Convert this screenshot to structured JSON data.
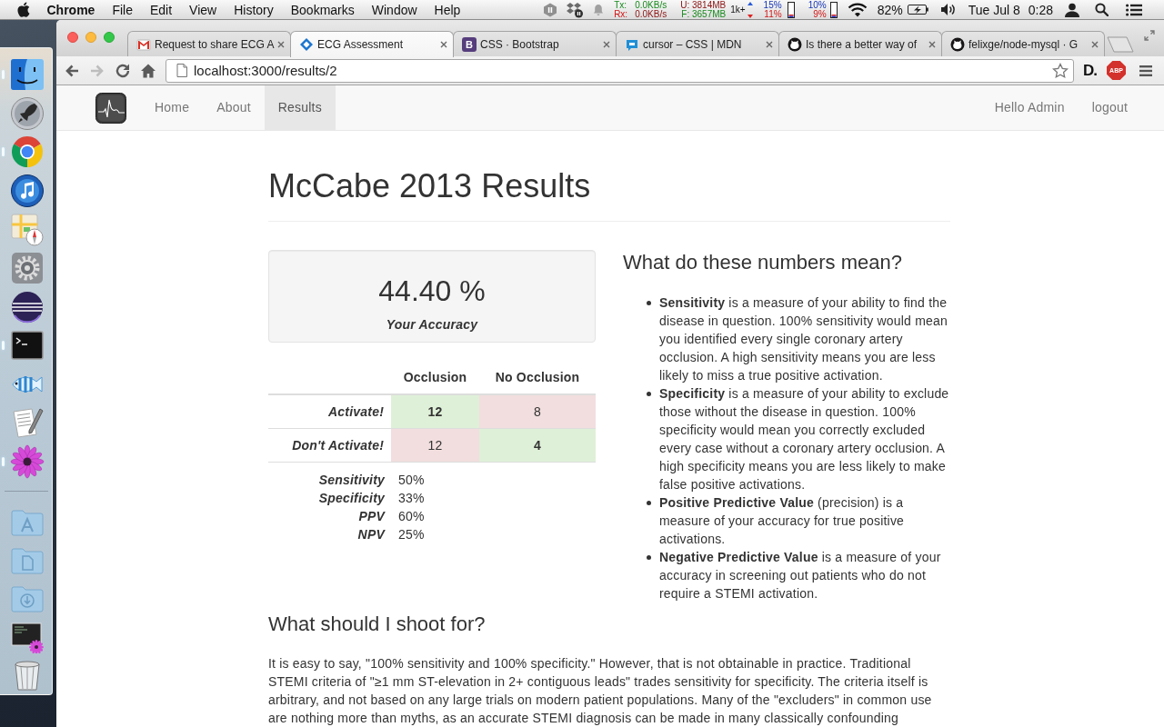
{
  "menu_bar": {
    "app_name": "Chrome",
    "menus": [
      "File",
      "Edit",
      "View",
      "History",
      "Bookmarks",
      "Window",
      "Help"
    ],
    "network": {
      "tx_label": "Tx:",
      "tx": "0.0KB/s",
      "rx_label": "Rx:",
      "rx": "0.0KB/s"
    },
    "memory": {
      "used": "U: 3814MB",
      "free": "F: 3657MB"
    },
    "counter": "1k+",
    "cpu": [
      {
        "user": "15%",
        "system": "11%"
      },
      {
        "user": "10%",
        "system": "9%"
      }
    ],
    "battery": "82%",
    "date": "Tue Jul 8",
    "time": "0:28"
  },
  "dock": {
    "apps": [
      {
        "kind": "finder",
        "running": true
      },
      {
        "kind": "launchpad",
        "running": false
      },
      {
        "kind": "chrome",
        "running": true
      },
      {
        "kind": "itunes",
        "running": false
      },
      {
        "kind": "maps",
        "running": false
      },
      {
        "kind": "preferences",
        "running": false
      },
      {
        "kind": "eclipse",
        "running": false
      },
      {
        "kind": "terminal",
        "running": true
      },
      {
        "kind": "fish",
        "running": false
      },
      {
        "kind": "textedit",
        "running": false
      },
      {
        "kind": "flower",
        "running": true
      }
    ],
    "stacks": [
      {
        "kind": "applications"
      },
      {
        "kind": "documents"
      },
      {
        "kind": "downloads"
      },
      {
        "kind": "screenshots"
      },
      {
        "kind": "trash"
      }
    ]
  },
  "browser": {
    "tabs": [
      {
        "title": "Request to share ECG A",
        "favicon": {
          "kind": "mail"
        },
        "selected": false
      },
      {
        "title": "ECG Assessment",
        "favicon": {
          "kind": "diamond"
        },
        "selected": true
      },
      {
        "title": "CSS · Bootstrap",
        "favicon": {
          "kind": "letter",
          "text": "B"
        },
        "selected": false
      },
      {
        "title": "cursor – CSS | MDN",
        "favicon": {
          "kind": "bubble"
        },
        "selected": false
      },
      {
        "title": "Is there a better way of",
        "favicon": {
          "kind": "cat"
        },
        "selected": false
      },
      {
        "title": "felixge/node-mysql · G",
        "favicon": {
          "kind": "cat"
        },
        "selected": false
      }
    ],
    "nav_buttons": [
      {
        "kind": "back",
        "disabled": false
      },
      {
        "kind": "forward",
        "disabled": true
      },
      {
        "kind": "reload",
        "disabled": false
      },
      {
        "kind": "home",
        "disabled": false
      }
    ],
    "address": "localhost:3000/results/2",
    "extensions": [
      {
        "kind": "letter",
        "text": "D."
      },
      {
        "kind": "octagon",
        "text": "ABP"
      }
    ]
  },
  "page": {
    "navbar": {
      "links": [
        {
          "label": "Home",
          "selected": false
        },
        {
          "label": "About",
          "selected": false
        },
        {
          "label": "Results",
          "selected": true
        }
      ],
      "greeting": "Hello Admin",
      "logout": "logout"
    },
    "title": "McCabe 2013 Results",
    "accuracy": {
      "value": "44.40 %",
      "label": "Your Accuracy"
    },
    "confusion_table": {
      "columns": [
        "Occlusion",
        "No Occlusion"
      ],
      "rows": [
        {
          "label": "Activate!",
          "cells": [
            {
              "value": "12",
              "correct": true
            },
            {
              "value": "8",
              "correct": false
            }
          ]
        },
        {
          "label": "Don't Activate!",
          "cells": [
            {
              "value": "12",
              "correct": false
            },
            {
              "value": "4",
              "correct": true
            }
          ]
        }
      ]
    },
    "stats": [
      {
        "label": "Sensitivity",
        "value": "50%"
      },
      {
        "label": "Specificity",
        "value": "33%"
      },
      {
        "label": "PPV",
        "value": "60%"
      },
      {
        "label": "NPV",
        "value": "25%"
      }
    ],
    "explanation": {
      "heading": "What do these numbers mean?",
      "items": [
        "**Sensitivity** is a measure of your ability to find the disease in question. 100% sensitivity would mean you identified every single coronary artery occlusion. A high sensitivity means you are less likely to miss a true positive activation.",
        "**Specificity** is a measure of your ability to exclude those without the disease in question. 100% specificity would mean you correctly excluded every case without a coronary artery occlusion. A high specificity means you are less likely to make false positive activations.",
        "**Positive Predictive Value** (precision) is a measure of your accuracy for true positive activations.",
        "**Negative Predictive Value** is a measure of your accuracy in screening out patients who do not require a STEMI activation."
      ]
    },
    "target": {
      "heading": "What should I shoot for?",
      "paragraph": "It is easy to say, \"100% sensitivity and 100% specificity.\" However, that is not obtainable in practice. Traditional STEMI criteria of \"≥1 mm ST-elevation in 2+ contiguous leads\" trades sensitivity for specificity. The criteria itself is arbitrary, and not based on any large trials on modern patient populations. Many of the \"excluders\" in common use are nothing more than myths, as an accurate STEMI diagnosis can be made in many classically confounding"
    }
  }
}
